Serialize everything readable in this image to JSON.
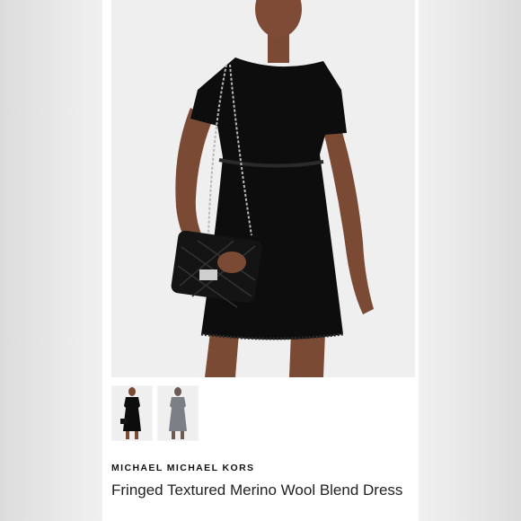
{
  "product": {
    "brand": "MICHAEL MICHAEL KORS",
    "name": "Fringed Textured Merino Wool Blend Dress",
    "main_image_icon": "model-photo-icon",
    "thumbnails": [
      {
        "icon": "dress-front-thumbnail-icon",
        "selected": true
      },
      {
        "icon": "dress-model-gray-thumbnail-icon",
        "selected": false
      }
    ]
  },
  "colors": {
    "dress": "#0d0d0d",
    "background": "#efefef",
    "skin": "#7a4a34"
  }
}
